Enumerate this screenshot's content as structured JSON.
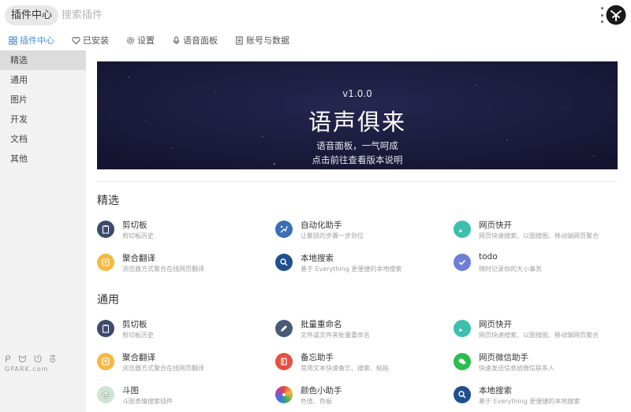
{
  "header": {
    "app_title": "插件中心",
    "search_placeholder": "搜索插件"
  },
  "tabs": [
    {
      "label": "插件中心",
      "icon": "grid-icon",
      "active": true
    },
    {
      "label": "已安装",
      "icon": "heart-icon",
      "active": false
    },
    {
      "label": "设置",
      "icon": "gear-icon",
      "active": false
    },
    {
      "label": "语音面板",
      "icon": "microphone-icon",
      "active": false
    },
    {
      "label": "账号与数据",
      "icon": "document-icon",
      "active": false
    }
  ],
  "sidebar": {
    "items": [
      {
        "label": "精选",
        "active": true
      },
      {
        "label": "通用",
        "active": false
      },
      {
        "label": "图片",
        "active": false
      },
      {
        "label": "开发",
        "active": false
      },
      {
        "label": "文档",
        "active": false
      },
      {
        "label": "其他",
        "active": false
      }
    ]
  },
  "banner": {
    "version": "v1.0.0",
    "title": "语声俱来",
    "line1": "语音面板，一气呵成",
    "line2": "点击前往查看版本说明"
  },
  "sections": [
    {
      "title": "精选",
      "plugins": [
        {
          "name": "剪切板",
          "desc": "剪切板历史",
          "icon": "clipboard-icon",
          "color": "#3d4a6b"
        },
        {
          "name": "自动化助手",
          "desc": "让繁琐的步骤一步到位",
          "icon": "automation-icon",
          "color": "#3b6fb6"
        },
        {
          "name": "网页快开",
          "desc": "网页快速搜索、以图搜图、移动端网页聚合",
          "icon": "rocket-icon",
          "color": "#3dbfae"
        },
        {
          "name": "聚合翻译",
          "desc": "浏览器方式聚合在线网页翻译",
          "icon": "translate-icon",
          "color": "#f5b942"
        },
        {
          "name": "本地搜索",
          "desc": "基于 Everything 更便捷的本地搜索",
          "icon": "search-icon",
          "color": "#1f4f8f"
        },
        {
          "name": "todo",
          "desc": "随时记录你的大小事务",
          "icon": "check-icon",
          "color": "#6e7fd6"
        }
      ]
    },
    {
      "title": "通用",
      "plugins": [
        {
          "name": "剪切板",
          "desc": "剪切板历史",
          "icon": "clipboard-icon",
          "color": "#3d4a6b"
        },
        {
          "name": "批量重命名",
          "desc": "文件或文件夹批量重命名",
          "icon": "rename-icon",
          "color": "#4a5a78"
        },
        {
          "name": "网页快开",
          "desc": "网页快速搜索、以图搜图、移动端网页聚合",
          "icon": "rocket-icon",
          "color": "#3dbfae"
        },
        {
          "name": "聚合翻译",
          "desc": "浏览器方式聚合在线网页翻译",
          "icon": "translate-icon",
          "color": "#f5b942"
        },
        {
          "name": "备忘助手",
          "desc": "常用文本快速备忘、搜索、粘贴",
          "icon": "memo-icon",
          "color": "#e5503f"
        },
        {
          "name": "网页微信助手",
          "desc": "快速发送信息给微信联系人",
          "icon": "wechat-icon",
          "color": "#2bbd4f"
        },
        {
          "name": "斗图",
          "desc": "斗图表情搜索插件",
          "icon": "face-icon",
          "color": "#cfe3d6"
        },
        {
          "name": "颜色小助手",
          "desc": "色值、色板",
          "icon": "color-wheel-icon",
          "color": "#e8453c"
        },
        {
          "name": "本地搜索",
          "desc": "基于 Everything 更便捷的本地搜索",
          "icon": "search-icon",
          "color": "#1f4f8f"
        }
      ]
    }
  ],
  "watermark": {
    "glyphs": "ᑭ ᗢ ᘎ ᘔ",
    "text": "GPARK.com"
  }
}
